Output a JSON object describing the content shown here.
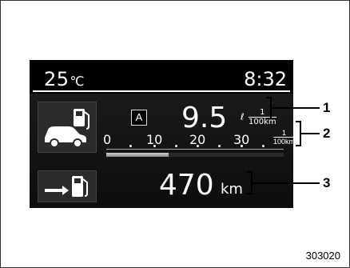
{
  "status_bar": {
    "temperature": "25",
    "temperature_unit": "℃",
    "time": "8:32"
  },
  "fuel_economy": {
    "mode_badge": "A",
    "value": "9.5",
    "unit_prefix": "ℓ",
    "unit_numerator": "1",
    "unit_denominator": "100km"
  },
  "economy_scale": {
    "labels": [
      "0",
      "10",
      "20",
      "30"
    ],
    "unit_numerator": "1",
    "unit_denominator": "100km",
    "bar_fraction": 0.35
  },
  "driving_range": {
    "value": "470",
    "unit": "km"
  },
  "callouts": [
    "1",
    "2",
    "3"
  ],
  "figure_id": "303020",
  "icons": {
    "car_fuel": "car-fuel-pump-icon",
    "range": "fuel-range-icon"
  },
  "colors": {
    "screen_bg": "#000000",
    "text": "#ffffff",
    "bar": "#b0b0b0"
  }
}
